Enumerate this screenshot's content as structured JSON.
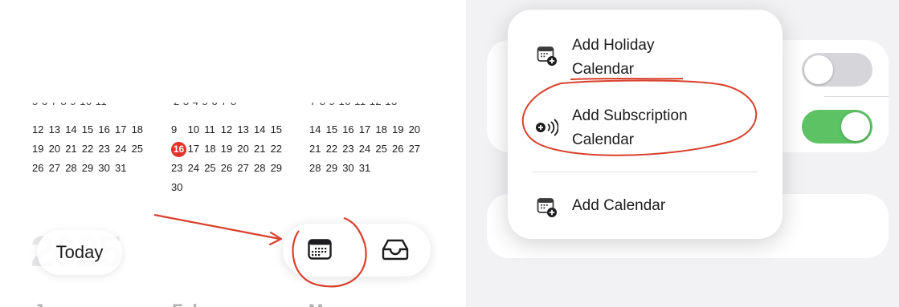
{
  "calendar": {
    "months": [
      {
        "weeks": [
          [
            "12",
            "13",
            "14",
            "15",
            "16",
            "17",
            "18"
          ],
          [
            "19",
            "20",
            "21",
            "22",
            "23",
            "24",
            "25"
          ],
          [
            "26",
            "27",
            "28",
            "29",
            "30",
            "31"
          ]
        ]
      },
      {
        "weeks": [
          [
            "9",
            "10",
            "11",
            "12",
            "13",
            "14",
            "15"
          ],
          [
            "16",
            "17",
            "18",
            "19",
            "20",
            "21",
            "22"
          ],
          [
            "23",
            "24",
            "25",
            "26",
            "27",
            "28",
            "29"
          ],
          [
            "30"
          ]
        ],
        "today": "16"
      },
      {
        "weeks": [
          [
            "14",
            "15",
            "16",
            "17",
            "18",
            "19",
            "20"
          ],
          [
            "21",
            "22",
            "23",
            "24",
            "25",
            "26",
            "27"
          ],
          [
            "28",
            "29",
            "30",
            "31"
          ]
        ]
      }
    ]
  },
  "year_label": "2025",
  "toolbar": {
    "today_label": "Today"
  },
  "menu": {
    "items": [
      {
        "label_line1": "Add Holiday",
        "label_line2": "Calendar"
      },
      {
        "label_line1": "Add Subscription",
        "label_line2": "Calendar"
      },
      {
        "label_line1": "Add Calendar",
        "label_line2": ""
      }
    ]
  },
  "toggles": [
    {
      "state": "off"
    },
    {
      "state": "on"
    }
  ],
  "colors": {
    "accent_red": "#e5322b",
    "toggle_on": "#5cc264",
    "toggle_off": "#d6d6da",
    "annotation": "#d8402c"
  }
}
